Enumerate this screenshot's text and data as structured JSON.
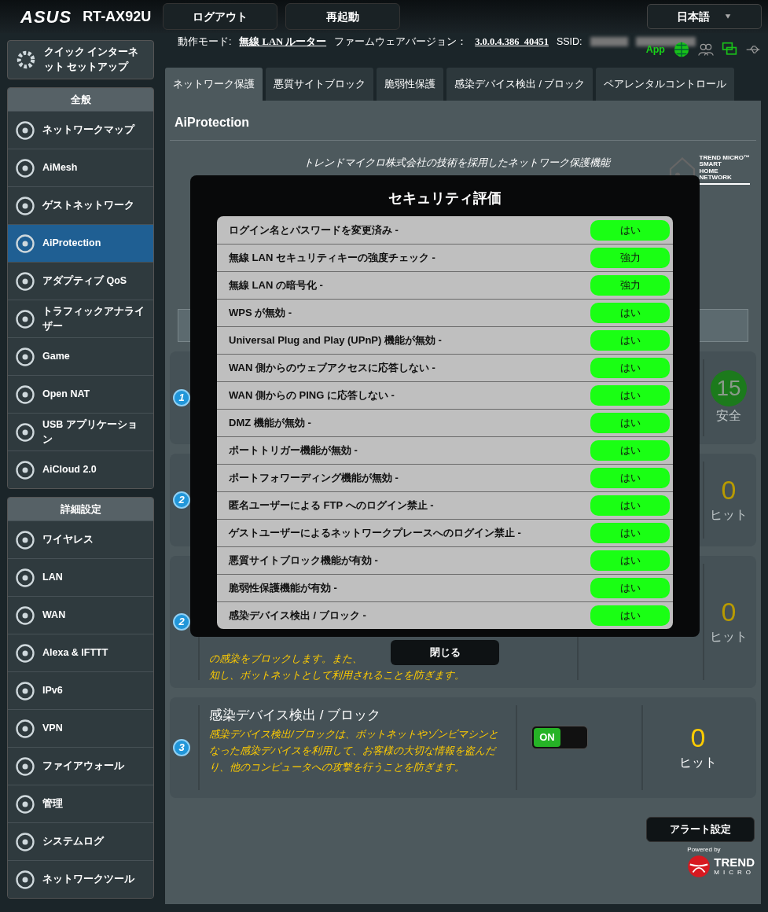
{
  "header": {
    "logo": "ASUS",
    "model": "RT-AX92U",
    "buttons": [
      "ログアウト",
      "再起動"
    ],
    "language": "日本語"
  },
  "sidebar": {
    "quick_setup": "クイック インターネット セットアップ",
    "sections": [
      {
        "title": "全般",
        "items": [
          {
            "label": "ネットワークマップ",
            "selected": false
          },
          {
            "label": "AiMesh",
            "selected": false
          },
          {
            "label": "ゲストネットワーク",
            "selected": false
          },
          {
            "label": "AiProtection",
            "selected": true
          },
          {
            "label": "アダプティブ QoS",
            "selected": false
          },
          {
            "label": "トラフィックアナライザー",
            "selected": false
          },
          {
            "label": "Game",
            "selected": false
          },
          {
            "label": "Open NAT",
            "selected": false
          },
          {
            "label": "USB アプリケーション",
            "selected": false
          },
          {
            "label": "AiCloud 2.0",
            "selected": false
          }
        ]
      },
      {
        "title": "詳細設定",
        "items": [
          {
            "label": "ワイヤレス",
            "selected": false
          },
          {
            "label": "LAN",
            "selected": false
          },
          {
            "label": "WAN",
            "selected": false
          },
          {
            "label": "Alexa & IFTTT",
            "selected": false
          },
          {
            "label": "IPv6",
            "selected": false
          },
          {
            "label": "VPN",
            "selected": false
          },
          {
            "label": "ファイアウォール",
            "selected": false
          },
          {
            "label": "管理",
            "selected": false
          },
          {
            "label": "システムログ",
            "selected": false
          },
          {
            "label": "ネットワークツール",
            "selected": false
          }
        ]
      }
    ]
  },
  "info": {
    "mode_label": "動作モード:",
    "mode": "無線 LAN ルーター",
    "firmware_label": "ファームウェアバージョン：",
    "firmware": "3.0.0.4.386_40451",
    "ssid_label": "SSID:",
    "app": "App"
  },
  "tabs": [
    {
      "label": "ネットワーク保護",
      "selected": true
    },
    {
      "label": "悪質サイトブロック",
      "selected": false
    },
    {
      "label": "脆弱性保護",
      "selected": false
    },
    {
      "label": "感染デバイス検出 / ブロック",
      "selected": false
    },
    {
      "label": "ペアレンタルコントロール",
      "selected": false
    }
  ],
  "panel": {
    "title": "AiProtection",
    "intro": "トレンドマイクロ株式会社の技術を採用したネットワーク保護機能",
    "partner_logo": [
      "TREND MICRO™",
      "SMART",
      "HOME",
      "NETWORK"
    ]
  },
  "cards": [
    {
      "number": "1",
      "value": "15",
      "unit": "安全",
      "kind": "score"
    },
    {
      "number": "2",
      "value": "0",
      "unit": "ヒット",
      "kind": "hits"
    },
    {
      "number": "2",
      "value": "0",
      "unit": "ヒット",
      "kind": "hits",
      "description_lines": [
        "の感染をブロックします。また、",
        "知し、ボットネットとして利用されることを防ぎます。"
      ]
    },
    {
      "number": "3",
      "value": "0",
      "unit": "ヒット",
      "kind": "hits",
      "title": "感染デバイス検出 / ブロック",
      "description": "感染デバイス検出/ブロックは、ボットネットやゾンビマシンとなった感染デバイスを利用して、お客様の大切な情報を盗んだり、他のコンピュータへの攻撃を行うことを防ぎます。",
      "toggle": {
        "label": "ON",
        "on": true
      }
    }
  ],
  "alert_button": "アラート設定",
  "powered": {
    "caption": "Powered by",
    "brand": "TREND",
    "sub": "MICRO"
  },
  "modal": {
    "title": "セキュリティ評価",
    "rows": [
      {
        "label": "ログイン名とパスワードを変更済み -",
        "value": "はい"
      },
      {
        "label": "無線 LAN セキュリティキーの強度チェック -",
        "value": "強力"
      },
      {
        "label": "無線 LAN の暗号化 -",
        "value": "強力"
      },
      {
        "label": "WPS が無効 -",
        "value": "はい"
      },
      {
        "label": "Universal Plug and Play (UPnP) 機能が無効 -",
        "value": "はい"
      },
      {
        "label": "WAN 側からのウェブアクセスに応答しない -",
        "value": "はい"
      },
      {
        "label": "WAN 側からの PING に応答しない -",
        "value": "はい"
      },
      {
        "label": "DMZ 機能が無効 -",
        "value": "はい"
      },
      {
        "label": "ポートトリガー機能が無効 -",
        "value": "はい"
      },
      {
        "label": "ポートフォワーディング機能が無効 -",
        "value": "はい"
      },
      {
        "label": "匿名ユーザーによる FTP へのログイン禁止 -",
        "value": "はい"
      },
      {
        "label": "ゲストユーザーによるネットワークプレースへのログイン禁止 -",
        "value": "はい"
      },
      {
        "label": "悪質サイトブロック機能が有効 -",
        "value": "はい"
      },
      {
        "label": "脆弱性保護機能が有効 -",
        "value": "はい"
      },
      {
        "label": "感染デバイス検出 / ブロック -",
        "value": "はい"
      }
    ],
    "close": "閉じる"
  }
}
